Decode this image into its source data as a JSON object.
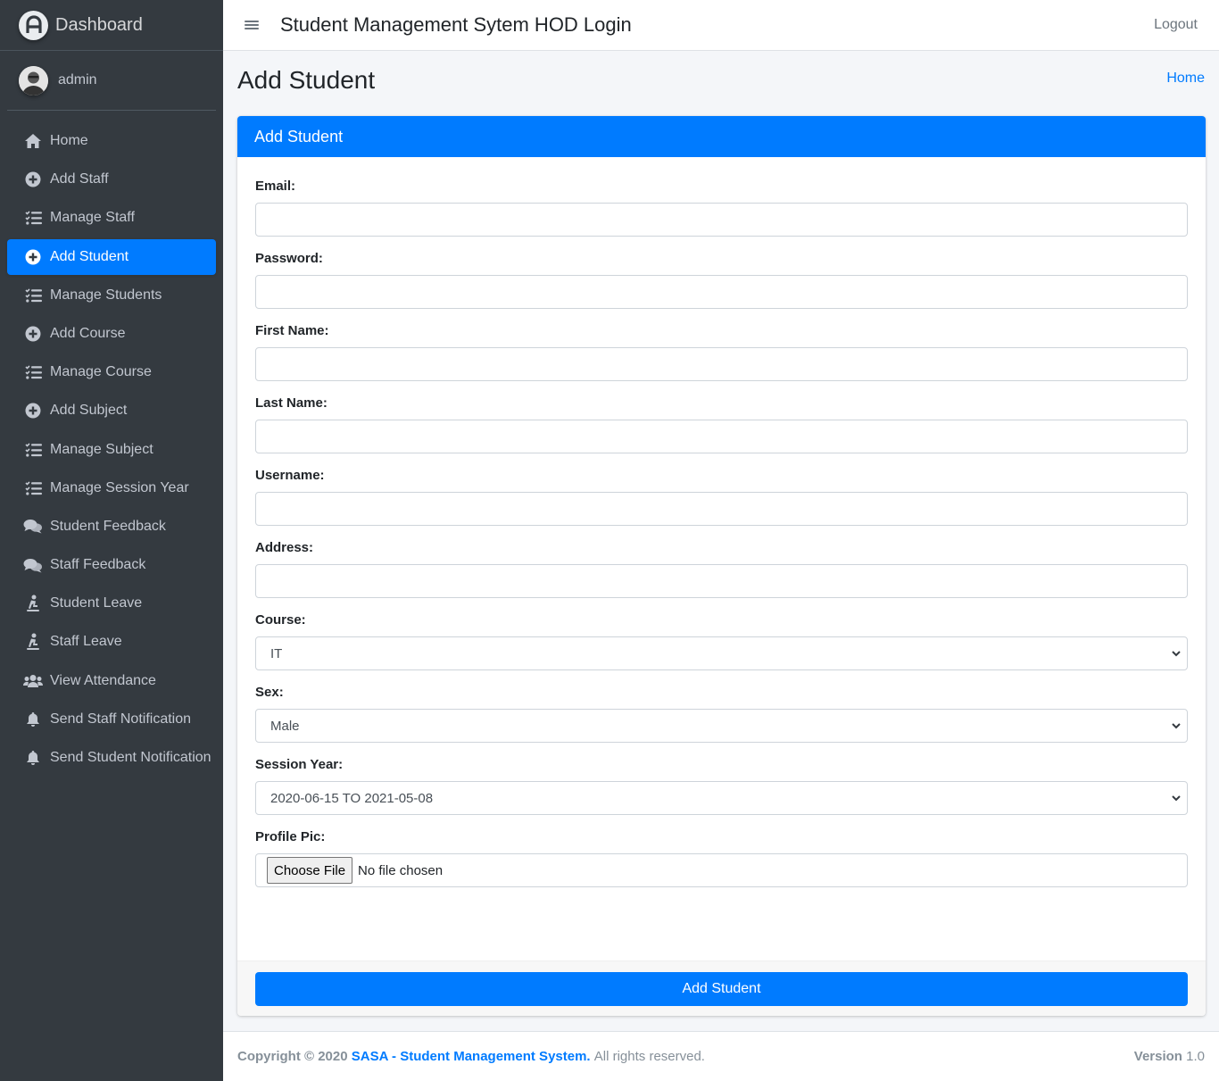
{
  "brand": {
    "title": "Dashboard"
  },
  "user": {
    "name": "admin"
  },
  "sidebar": {
    "items": [
      {
        "label": "Home",
        "icon": "home-icon"
      },
      {
        "label": "Add Staff",
        "icon": "plus-circle-icon"
      },
      {
        "label": "Manage Staff",
        "icon": "tasks-icon"
      },
      {
        "label": "Add Student",
        "icon": "plus-circle-icon",
        "active": true
      },
      {
        "label": "Manage Students",
        "icon": "tasks-icon"
      },
      {
        "label": "Add Course",
        "icon": "plus-circle-icon"
      },
      {
        "label": "Manage Course",
        "icon": "tasks-icon"
      },
      {
        "label": "Add Subject",
        "icon": "plus-circle-icon"
      },
      {
        "label": "Manage Subject",
        "icon": "tasks-icon"
      },
      {
        "label": "Manage Session Year",
        "icon": "tasks-icon"
      },
      {
        "label": "Student Feedback",
        "icon": "comments-icon"
      },
      {
        "label": "Staff Feedback",
        "icon": "comments-icon"
      },
      {
        "label": "Student Leave",
        "icon": "leave-icon"
      },
      {
        "label": "Staff Leave",
        "icon": "leave-icon"
      },
      {
        "label": "View Attendance",
        "icon": "users-icon"
      },
      {
        "label": "Send Staff Notification",
        "icon": "bell-icon"
      },
      {
        "label": "Send Student Notification",
        "icon": "bell-icon"
      }
    ]
  },
  "topbar": {
    "title": "Student Management Sytem HOD Login",
    "logout": "Logout"
  },
  "page": {
    "title": "Add Student",
    "breadcrumb": "Home"
  },
  "form": {
    "header": "Add Student",
    "labels": {
      "email": "Email:",
      "password": "Password:",
      "first_name": "First Name:",
      "last_name": "Last Name:",
      "username": "Username:",
      "address": "Address:",
      "course": "Course:",
      "sex": "Sex:",
      "session_year": "Session Year:",
      "profile_pic": "Profile Pic:"
    },
    "values": {
      "email": "",
      "password": "",
      "first_name": "",
      "last_name": "",
      "username": "",
      "address": "",
      "course": "IT",
      "sex": "Male",
      "session_year": "2020-06-15 TO 2021-05-08"
    },
    "file_button": "Choose File",
    "file_status": "No file chosen",
    "submit": "Add Student"
  },
  "footer": {
    "copyright": "Copyright © 2020",
    "link": "SASA - Student Management System.",
    "rights": "All rights reserved.",
    "version_label": "Version",
    "version": "1.0"
  },
  "colors": {
    "accent": "#007bff",
    "sidebar_bg": "#343a40"
  }
}
